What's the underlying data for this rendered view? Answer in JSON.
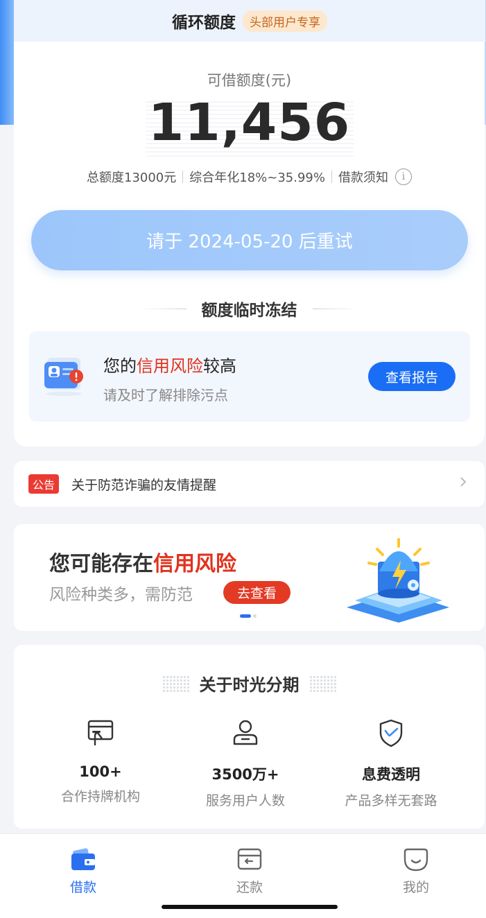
{
  "header": {
    "title": "循环额度",
    "badge": "头部用户专享"
  },
  "limit": {
    "label": "可借额度(元)",
    "amount": "11,456",
    "total": "总额度13000元",
    "rate": "综合年化18%~35.99%",
    "notice_link": "借款须知",
    "info_icon_glyph": "i"
  },
  "retry_button": {
    "label": "请于 2024-05-20 后重试"
  },
  "frozen": {
    "title": "额度临时冻结"
  },
  "risk": {
    "title_prefix": "您的",
    "title_highlight": "信用风险",
    "title_suffix": "较高",
    "subtitle": "请及时了解排除污点",
    "button": "查看报告",
    "icon": "credit-report-alert-icon"
  },
  "notice": {
    "tag": "公告",
    "text": "关于防范诈骗的友情提醒"
  },
  "banner": {
    "title_prefix": "您可能存在",
    "title_highlight": "信用风险",
    "subtitle": "风险种类多，需防范",
    "button": "去查看",
    "page_count": 2,
    "active_page": 1
  },
  "about": {
    "title": "关于时光分期",
    "features": [
      {
        "icon": "institution-card-icon",
        "value": "100+",
        "desc": "合作持牌机构"
      },
      {
        "icon": "user-icon",
        "value": "3500万+",
        "desc": "服务用户人数"
      },
      {
        "icon": "shield-check-icon",
        "value": "息费透明",
        "desc": "产品多样无套路"
      }
    ]
  },
  "tabbar": {
    "tabs": [
      {
        "label": "借款",
        "icon": "wallet-icon",
        "active": true
      },
      {
        "label": "还款",
        "icon": "repay-icon",
        "active": false
      },
      {
        "label": "我的",
        "icon": "profile-icon",
        "active": false
      }
    ]
  },
  "colors": {
    "primary": "#2a6ff0",
    "risk_red": "#e0321e",
    "retry_button": "#9cc6fb",
    "badge_bg": "#fde8cf",
    "badge_text": "#c4661e"
  }
}
